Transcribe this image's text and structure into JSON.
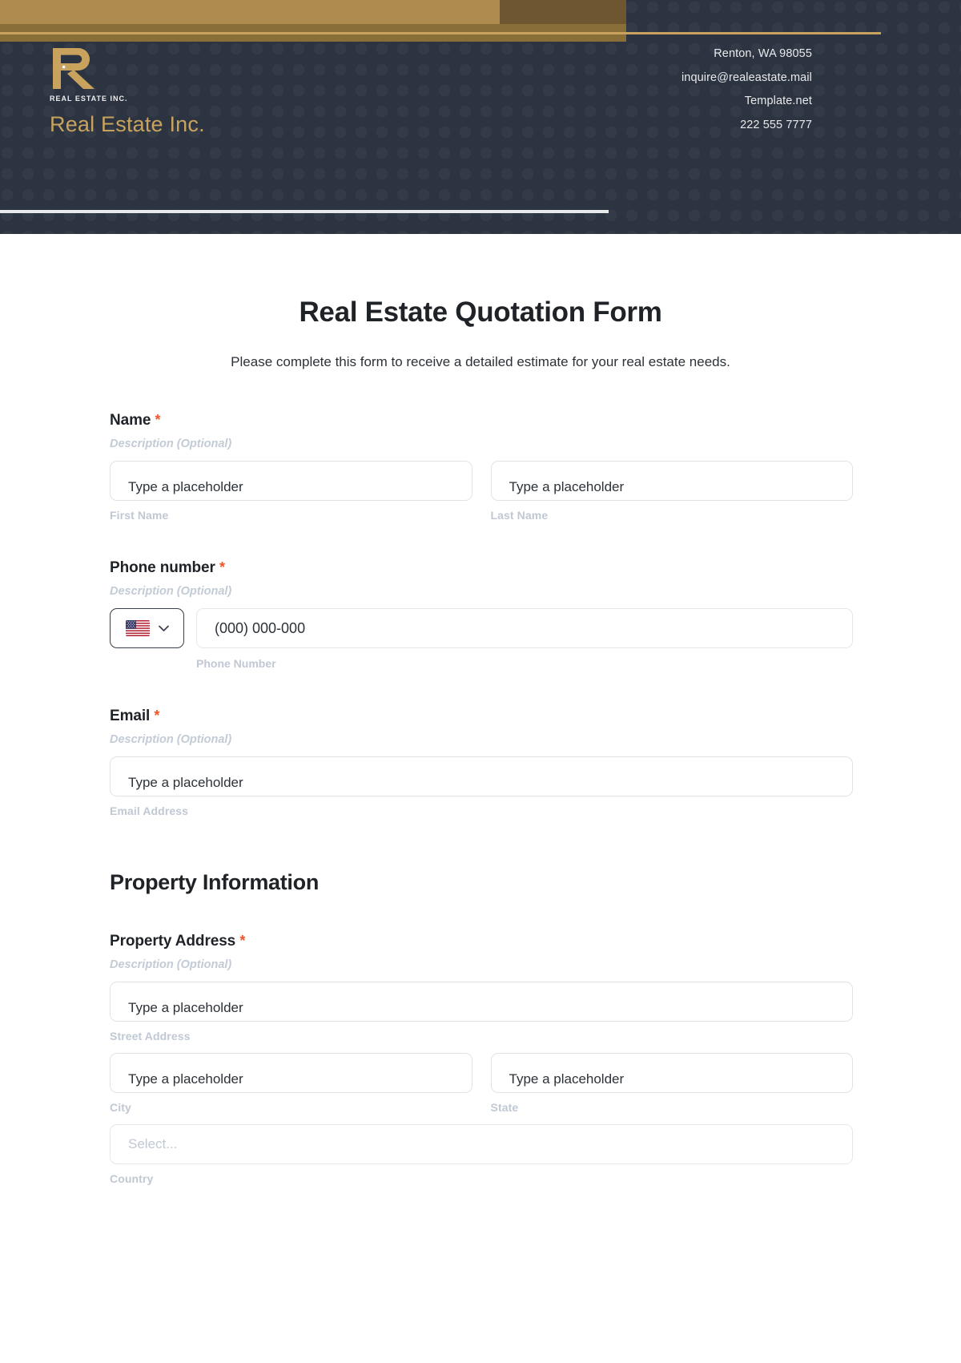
{
  "header": {
    "logo": {
      "monogram_alt": "R",
      "micro_text": "REAL ESTATE INC.",
      "company_name": "Real Estate Inc."
    },
    "contact": [
      "Renton, WA 98055",
      "inquire@realeastate.mail",
      "Template.net",
      "222 555 7777"
    ],
    "colors": {
      "background": "#2b3440",
      "gold": "#c9a35e",
      "tan_bar": "#b08b4f",
      "dark_bar": "#6e5730"
    }
  },
  "form": {
    "title": "Real Estate Quotation Form",
    "subtitle": "Please complete this form to receive a detailed estimate for your real estate needs.",
    "required_marker": "*",
    "description_placeholder": "Description (Optional)",
    "text_placeholder": "Type a placeholder",
    "accent_required_color": "#f2542d",
    "fields": [
      {
        "label": "Name",
        "required": true,
        "description": "Description (Optional)",
        "inputs": [
          {
            "placeholder": "Type a placeholder",
            "sublabel": "First Name"
          },
          {
            "placeholder": "Type a placeholder",
            "sublabel": "Last Name"
          }
        ]
      },
      {
        "label": "Phone number",
        "required": true,
        "description": "Description (Optional)",
        "country_code_flag": "us-flag-icon",
        "inputs": [
          {
            "placeholder": "(000) 000-000",
            "sublabel": "Phone Number"
          }
        ]
      },
      {
        "label": "Email",
        "required": true,
        "description": "Description (Optional)",
        "inputs": [
          {
            "placeholder": "Type a placeholder",
            "sublabel": "Email Address"
          }
        ]
      }
    ],
    "sections": [
      {
        "heading": "Property Information",
        "fields": [
          {
            "label": "Property Address",
            "required": true,
            "description": "Description (Optional)",
            "inputs": [
              {
                "placeholder": "Type a placeholder",
                "sublabel": "Street Address"
              },
              {
                "placeholder": "Type a placeholder",
                "sublabel": "City"
              },
              {
                "placeholder": "Type a placeholder",
                "sublabel": "State"
              },
              {
                "placeholder": "Select...",
                "sublabel": "Country",
                "type": "select"
              }
            ]
          }
        ]
      }
    ]
  }
}
